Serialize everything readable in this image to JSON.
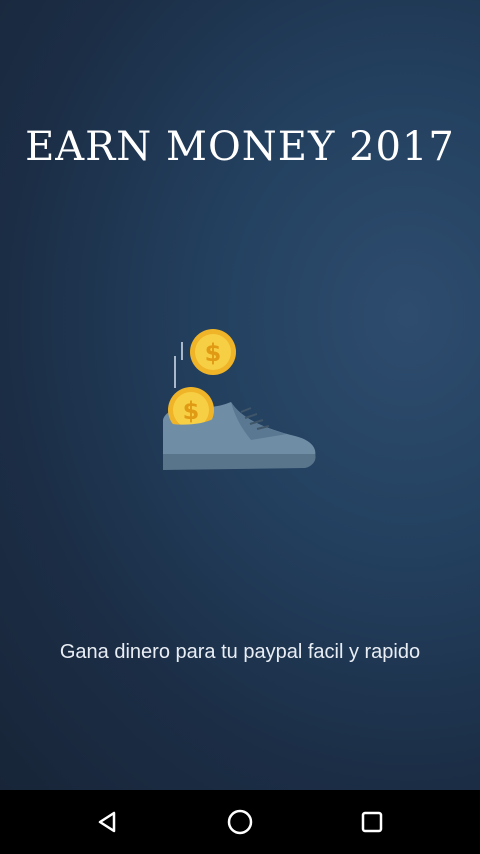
{
  "app": {
    "title": "EARN MONEY 2017",
    "subtitle": "Gana dinero para tu paypal facil y rapido"
  },
  "illustration": {
    "icon": "shoe-with-coins-icon",
    "coin_symbol": "$"
  },
  "navbar": {
    "back_icon": "back-triangle-icon",
    "home_icon": "home-circle-icon",
    "recents_icon": "recents-square-icon"
  },
  "colors": {
    "background": "#1c2d45",
    "coin": "#f5c23a",
    "shoe": "#6f8ea6",
    "text": "#ffffff"
  }
}
